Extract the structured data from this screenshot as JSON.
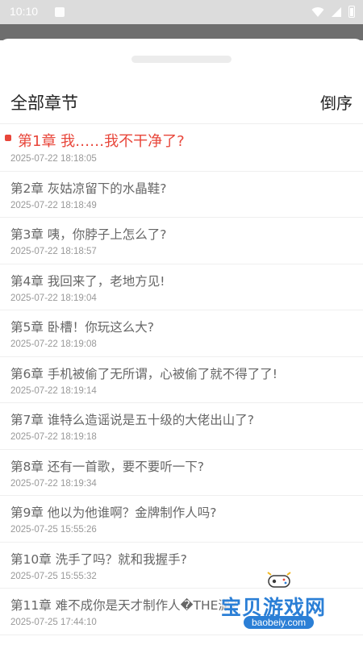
{
  "status_bar": {
    "time": "10:10",
    "icons": [
      "notification-icon",
      "wifi-icon",
      "signal-icon",
      "battery-icon"
    ]
  },
  "sheet": {
    "title": "全部章节",
    "sort_label": "倒序"
  },
  "chapters": [
    {
      "title": "第1章 我……我不干净了?",
      "time": "2025-07-22 18:18:05",
      "active": true
    },
    {
      "title": "第2章 灰姑凉留下的水晶鞋?",
      "time": "2025-07-22 18:18:49"
    },
    {
      "title": "第3章 咦，你脖子上怎么了?",
      "time": "2025-07-22 18:18:57"
    },
    {
      "title": "第4章 我回来了，老地方见!",
      "time": "2025-07-22 18:19:04"
    },
    {
      "title": "第5章 卧槽！你玩这么大?",
      "time": "2025-07-22 18:19:08"
    },
    {
      "title": "第6章 手机被偷了无所谓，心被偷了就不得了了!",
      "time": "2025-07-22 18:19:14"
    },
    {
      "title": "第7章 谁特么造谣说是五十级的大佬出山了?",
      "time": "2025-07-22 18:19:18"
    },
    {
      "title": "第8章 还有一首歌，要不要听一下?",
      "time": "2025-07-22 18:19:34"
    },
    {
      "title": "第9章 他以为他谁啊？金牌制作人吗?",
      "time": "2025-07-25 15:55:26"
    },
    {
      "title": "第10章 洗手了吗？就和我握手?",
      "time": "2025-07-25 15:55:32"
    },
    {
      "title": "第11章 难不成你是天才制作人�THE潇?",
      "time": "2025-07-25 17:44:10"
    }
  ],
  "watermark": {
    "text": "宝贝游戏网",
    "url": "baobeiy.com"
  },
  "colors": {
    "accent": "#e8463a",
    "watermark_blue": "#2b7fd6"
  }
}
